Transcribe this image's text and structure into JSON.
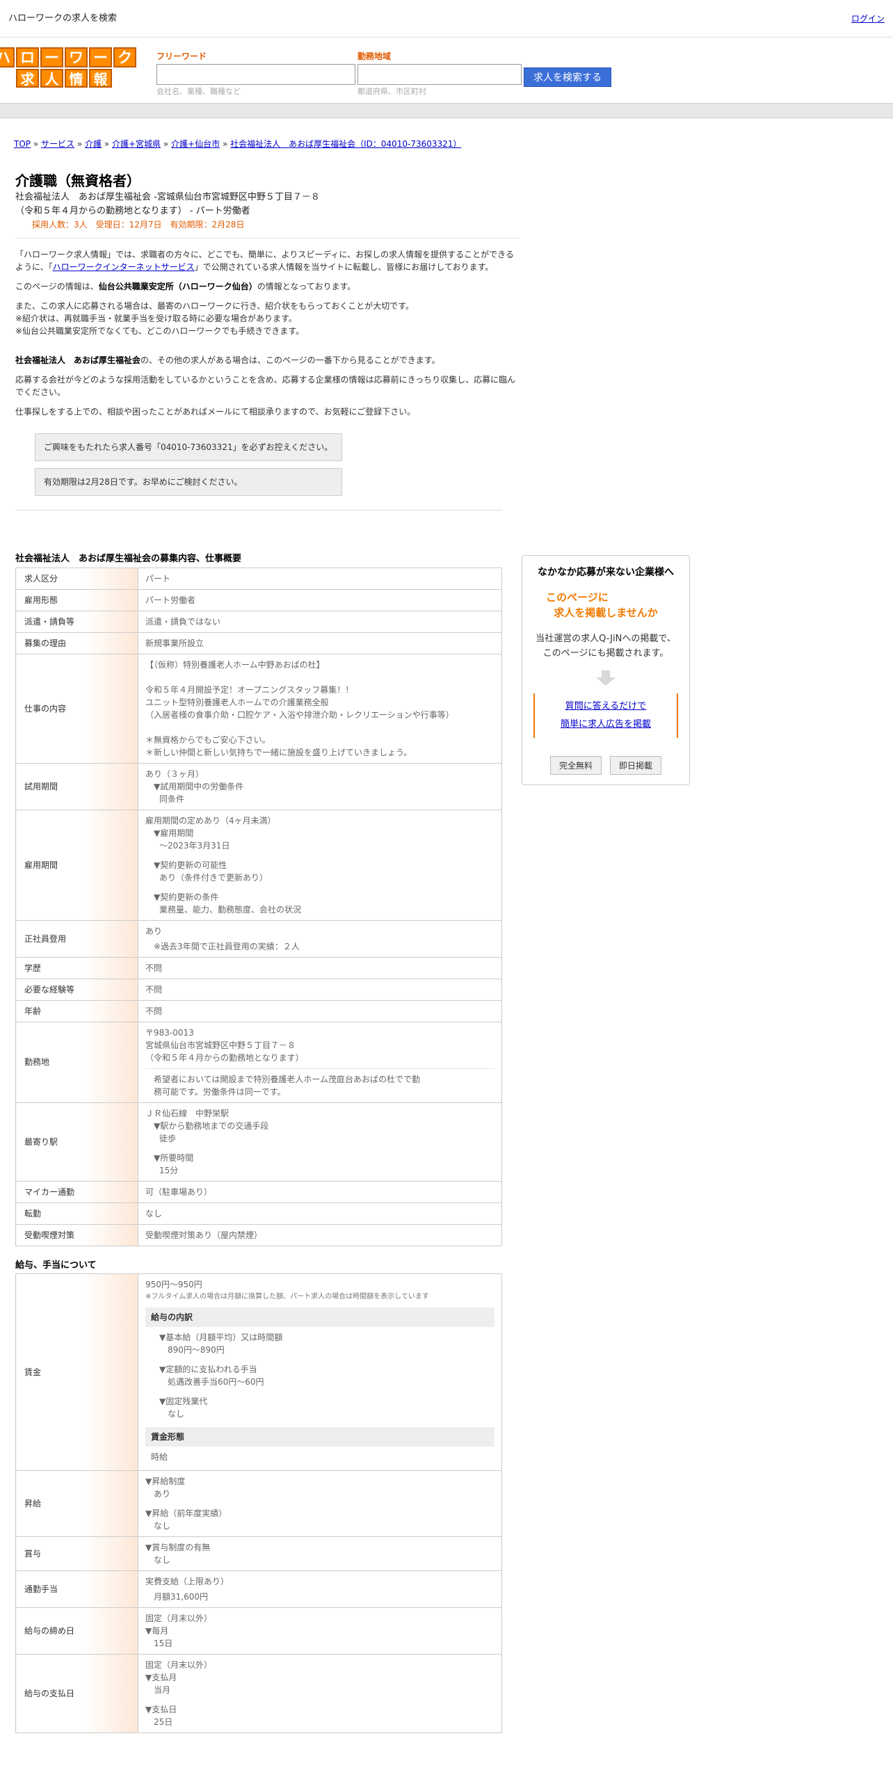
{
  "topbar": {
    "title": "ハローワークの求人を検索",
    "login": "ログイン"
  },
  "logo": {
    "line1": [
      "ハ",
      "ロ",
      "ー",
      "ワ",
      "ー",
      "ク"
    ],
    "line2": [
      "求",
      "人",
      "情",
      "報"
    ]
  },
  "search": {
    "freeword_label": "フリーワード",
    "freeword_placeholder": "会社名、業種、職種など",
    "area_label": "勤務地域",
    "area_placeholder": "都道府県、市区町村",
    "button": "求人を検索する"
  },
  "breadcrumb": [
    "TOP",
    "サービス",
    "介護",
    "介護+宮城県",
    "介護+仙台市",
    "社会福祉法人　あおば厚生福祉会（ID：04010-73603321）"
  ],
  "job": {
    "title": "介護職（無資格者）",
    "subtitle1": "社会福祉法人　あおば厚生福祉会 -宮城県仙台市宮城野区中野５丁目７－８",
    "subtitle2": "（令和５年４月からの勤務地となります） - パート労働者",
    "meta": "採用人数：3人　受理日：12月7日　有効期限：2月28日"
  },
  "intro": {
    "p1a": "「ハローワーク求人情報」では、求職者の方々に、どこでも、簡単に、よりスピーディに、お探しの求人情報を提供することができるように、「",
    "p1link": "ハローワークインターネットサービス",
    "p1b": "」で公開されている求人情報を当サイトに転載し、皆様にお届けしております。",
    "p2a": "このページの情報は、",
    "p2b": "仙台公共職業安定所（ハローワーク仙台）",
    "p2c": "の情報となっております。",
    "p3": "また、この求人に応募される場合は、最寄のハローワークに行き、紹介状をもらっておくことが大切です。",
    "p4": "※紹介状は、再就職手当・就業手当を受け取る時に必要な場合があります。",
    "p5": "※仙台公共職業安定所でなくても、どこのハローワークでも手続きできます。",
    "p6a": "社会福祉法人　あおば厚生福祉会",
    "p6b": "の、その他の求人がある場合は、このページの一番下から見ることができます。",
    "p7": "応募する会社が今どのような採用活動をしているかということを含め、応募する企業様の情報は応募前にきっちり収集し、応募に臨んでください。",
    "p8": "仕事探しをする上での、相談や困ったことがあればメールにて相談承りますので、お気軽にご登録下さい。",
    "note1": "ご興味をもたれたら求人番号「04010-73603321」を必ずお控えください。",
    "note2": "有効期限は2月28日です。お早めにご検討ください。"
  },
  "section1": "社会福祉法人　あおば厚生福祉会の募集内容、仕事概要",
  "table1": {
    "kubun": [
      "求人区分",
      "パート"
    ],
    "keitai": [
      "雇用形態",
      "パート労働者"
    ],
    "haken": [
      "派遣・請負等",
      "派遣・請負ではない"
    ],
    "riyu": [
      "募集の理由",
      "新規事業所設立"
    ],
    "naiyo_label": "仕事の内容",
    "naiyo": [
      "【（仮称）特別養護老人ホーム中野あおばの杜】",
      "",
      "令和５年４月開設予定！オープニングスタッフ募集！！",
      "ユニット型特別養護老人ホームでの介護業務全般",
      "（入居者様の食事介助・口腔ケア・入浴や排泄介助・レクリエーションや行事等）",
      "",
      "＊無資格からでもご安心下さい。",
      "＊新しい仲間と新しい気持ちで一緒に施設を盛り上げていきましょう。"
    ],
    "shiyo_label": "試用期間",
    "shiyo1": "あり（３ヶ月）",
    "shiyo2": "▼試用期間中の労働条件",
    "shiyo3": "同条件",
    "kikan_label": "雇用期間",
    "kikan1": "雇用期間の定めあり（4ヶ月未満）",
    "kikan2": "▼雇用期間",
    "kikan3": "〜2023年3月31日",
    "kikan4": "▼契約更新の可能性",
    "kikan5": "あり（条件付きで更新あり）",
    "kikan6": "▼契約更新の条件",
    "kikan7": "業務量、能力、勤務態度、会社の状況",
    "seishain_label": "正社員登用",
    "seishain1": "あり",
    "seishain2": "※過去3年間で正社員登用の実績：２人",
    "gakureki": [
      "学歴",
      "不問"
    ],
    "keiken": [
      "必要な経験等",
      "不問"
    ],
    "nenrei": [
      "年齢",
      "不問"
    ],
    "kinmu_label": "勤務地",
    "kinmu1": "〒983-0013",
    "kinmu2": "宮城県仙台市宮城野区中野５丁目７－８",
    "kinmu3": "（令和５年４月からの勤務地となります）",
    "kinmu4": "希望者においては開設まで特別養護老人ホーム茂庭台あおばの杜でで勤務可能です。労働条件は同一です。",
    "eki_label": "最寄り駅",
    "eki1": "ＪＲ仙石線　中野栄駅",
    "eki2": "▼駅から勤務地までの交通手段",
    "eki3": "徒歩",
    "eki4": "▼所要時間",
    "eki5": "15分",
    "mycar": [
      "マイカー通勤",
      "可（駐車場あり）"
    ],
    "tenkin": [
      "転勤",
      "なし"
    ],
    "kitsuen": [
      "受動喫煙対策",
      "受動喫煙対策あり（屋内禁煙）"
    ]
  },
  "section2": "給与、手当について",
  "table2": {
    "chingin_label": "賃金",
    "chingin1": "950円〜950円",
    "chingin_note": "※フルタイム求人の場合は月額に換算した額、パート求人の場合は時間額を表示しています",
    "uchiwake": "給与の内訳",
    "kihon": "▼基本給（月額平均）又は時間額",
    "kihon_v": "890円〜890円",
    "teigaku": "▼定額的に支払われる手当",
    "teigaku_v": "処遇改善手当60円〜60円",
    "kotei": "▼固定残業代",
    "kotei_v": "なし",
    "keitai": "賃金形態",
    "keitai_v": "時給",
    "shokyu_label": "昇給",
    "shokyu1": "▼昇給制度",
    "shokyu1v": "あり",
    "shokyu2": "▼昇給（前年度実績）",
    "shokyu2v": "なし",
    "shoyo_label": "賞与",
    "shoyo1": "▼賞与制度の有無",
    "shoyo1v": "なし",
    "tsukin_label": "通勤手当",
    "tsukin1": "実費支給（上限あり）",
    "tsukin2": "月額31,600円",
    "shime_label": "給与の締め日",
    "shime1": "固定（月末以外）",
    "shime2": "▼毎月",
    "shime3": "15日",
    "shiharai_label": "給与の支払日",
    "shiharai1": "固定（月末以外）",
    "shiharai2": "▼支払月",
    "shiharai3": "当月",
    "shiharai4": "▼支払日",
    "shiharai5": "25日"
  },
  "side": {
    "title": "なかなか応募が来ない企業様へ",
    "line1": "このページに",
    "line2": "求人を掲載しませんか",
    "desc1": "当社運営の求人Q-JiNへの掲載で、",
    "desc2": "このページにも掲載されます。",
    "link1": "質問に答えるだけで",
    "link2": "簡単に求人広告を掲載",
    "btn1": "完全無料",
    "btn2": "即日掲載"
  },
  "colors": {
    "accent": "#ff8c00",
    "orange_text": "#e05a00",
    "search_button": "#3b6fd8"
  }
}
